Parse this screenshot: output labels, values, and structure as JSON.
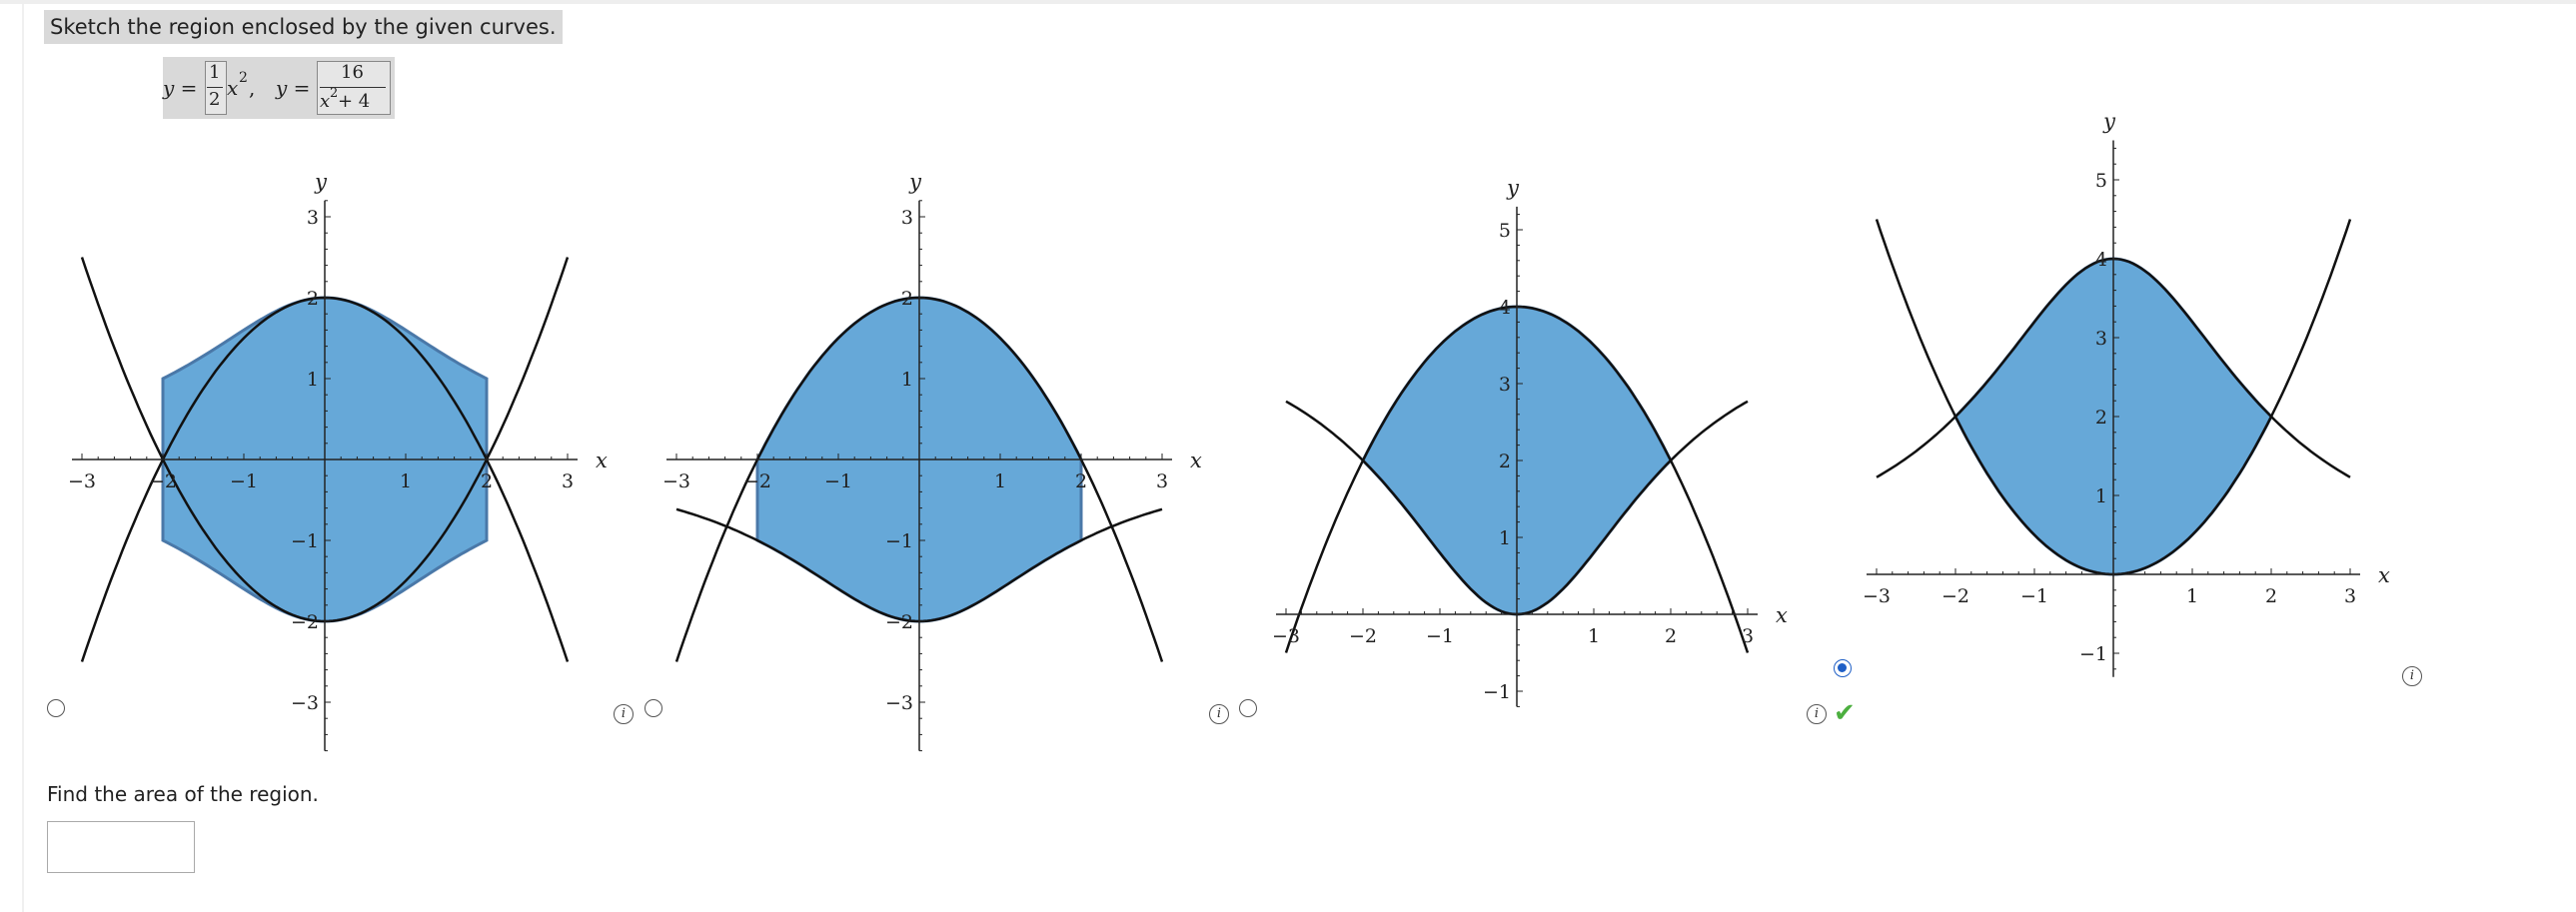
{
  "question": {
    "prompt": "Sketch the region enclosed by the given curves.",
    "formula": {
      "y1_lhs": "y =",
      "y1_num": "1",
      "y1_den": "2",
      "y1_var": "x",
      "y1_exp": "2",
      "separator": ",",
      "y2_lhs": "y =",
      "y2_num": "16",
      "y2_den_var": "x",
      "y2_den_exp": "2",
      "y2_den_rest": " + 4"
    }
  },
  "axis_labels": {
    "x": "x",
    "y": "y"
  },
  "options": [
    {
      "id": "A",
      "selected": false,
      "correct": false,
      "has_info": false,
      "xticks": [
        "−3",
        "−2",
        "−1",
        "1",
        "2",
        "3"
      ],
      "yticks": [
        "−3",
        "−2",
        "−1",
        "1",
        "2",
        "3"
      ],
      "xrange": [
        -3,
        3
      ],
      "yrange": [
        -3.6,
        3.2
      ]
    },
    {
      "id": "B",
      "selected": false,
      "correct": false,
      "has_info": true,
      "xticks": [
        "−3",
        "−2",
        "−1",
        "1",
        "2",
        "3"
      ],
      "yticks": [
        "−3",
        "−2",
        "−1",
        "1",
        "2",
        "3"
      ],
      "xrange": [
        -3,
        3
      ],
      "yrange": [
        -3.6,
        3.2
      ]
    },
    {
      "id": "C",
      "selected": false,
      "correct": false,
      "has_info": true,
      "xticks": [
        "−3",
        "−2",
        "−1",
        "1",
        "2",
        "3"
      ],
      "yticks": [
        "−1",
        "1",
        "2",
        "3",
        "4",
        "5"
      ],
      "xrange": [
        -3,
        3
      ],
      "yrange": [
        -1.2,
        5.3
      ]
    },
    {
      "id": "D",
      "selected": true,
      "correct": true,
      "has_info": true,
      "xticks": [
        "−3",
        "−2",
        "−1",
        "1",
        "2",
        "3"
      ],
      "yticks": [
        "−1",
        "1",
        "2",
        "3",
        "4",
        "5"
      ],
      "xrange": [
        -3,
        3
      ],
      "yrange": [
        -1.3,
        5.5
      ]
    }
  ],
  "find_area": {
    "label": "Find the area of the region.",
    "value": "",
    "placeholder": ""
  },
  "colors": {
    "region_fill": "#66a8d8",
    "region_stroke": "#4a78a8",
    "curve": "#111111",
    "selected_radio": "#1f5fc6",
    "correct_check": "#4caf3f"
  }
}
